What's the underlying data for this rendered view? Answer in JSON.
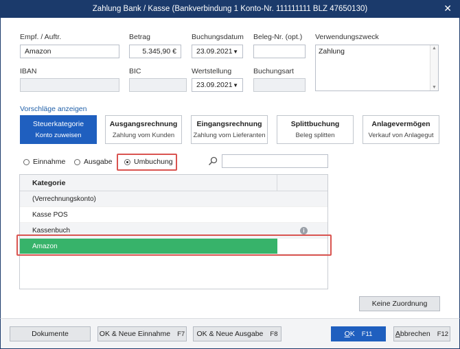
{
  "window": {
    "title": "Zahlung Bank / Kasse (Bankverbindung 1 Konto-Nr. 111111111  BLZ 47650130)"
  },
  "form": {
    "empf_label": "Empf. / Auftr.",
    "empf_value": "Amazon",
    "betrag_label": "Betrag",
    "betrag_value": "5.345,90 €",
    "buchungsdatum_label": "Buchungsdatum",
    "buchungsdatum_value": "23.09.2021",
    "beleg_label": "Beleg-Nr. (opt.)",
    "beleg_value": "",
    "verwendung_label": "Verwendungszweck",
    "verwendung_value": "Zahlung",
    "iban_label": "IBAN",
    "iban_value": "",
    "bic_label": "BIC",
    "bic_value": "",
    "wertstellung_label": "Wertstellung",
    "wertstellung_value": "23.09.2021",
    "buchungsart_label": "Buchungsart",
    "buchungsart_value": ""
  },
  "suggestions_link": "Vorschläge anzeigen",
  "categories": [
    {
      "title": "Steuerkategorie",
      "sub": "Konto zuweisen"
    },
    {
      "title": "Ausgangsrechnung",
      "sub": "Zahlung vom Kunden"
    },
    {
      "title": "Eingangsrechnung",
      "sub": "Zahlung vom Lieferanten"
    },
    {
      "title": "Splittbuchung",
      "sub": "Beleg splitten"
    },
    {
      "title": "Anlagevermögen",
      "sub": "Verkauf von Anlagegut"
    }
  ],
  "radios": {
    "einnahme": "Einnahme",
    "ausgabe": "Ausgabe",
    "umbuchung": "Umbuchung",
    "selected": "Umbuchung"
  },
  "search": {
    "value": ""
  },
  "table": {
    "header": "Kategorie",
    "rows": [
      "(Verrechnungskonto)",
      "Kasse POS",
      "Kassenbuch",
      "Amazon"
    ],
    "selected": "Amazon"
  },
  "buttons": {
    "keine_zuordnung": "Keine Zuordnung",
    "dokumente": "Dokumente",
    "ok_einnahme": "OK & Neue Einnahme",
    "ok_einnahme_key": "F7",
    "ok_ausgabe": "OK & Neue Ausgabe",
    "ok_ausgabe_key": "F8",
    "ok_first": "O",
    "ok_rest": "K",
    "ok_key": "F11",
    "abbrechen_first": "A",
    "abbrechen_rest": "bbrechen",
    "abbrechen_key": "F12"
  },
  "colors": {
    "titlebar": "#1b3a6b",
    "accent": "#1f5fbf",
    "selected_row": "#37b36a",
    "highlight": "#d9534f"
  }
}
